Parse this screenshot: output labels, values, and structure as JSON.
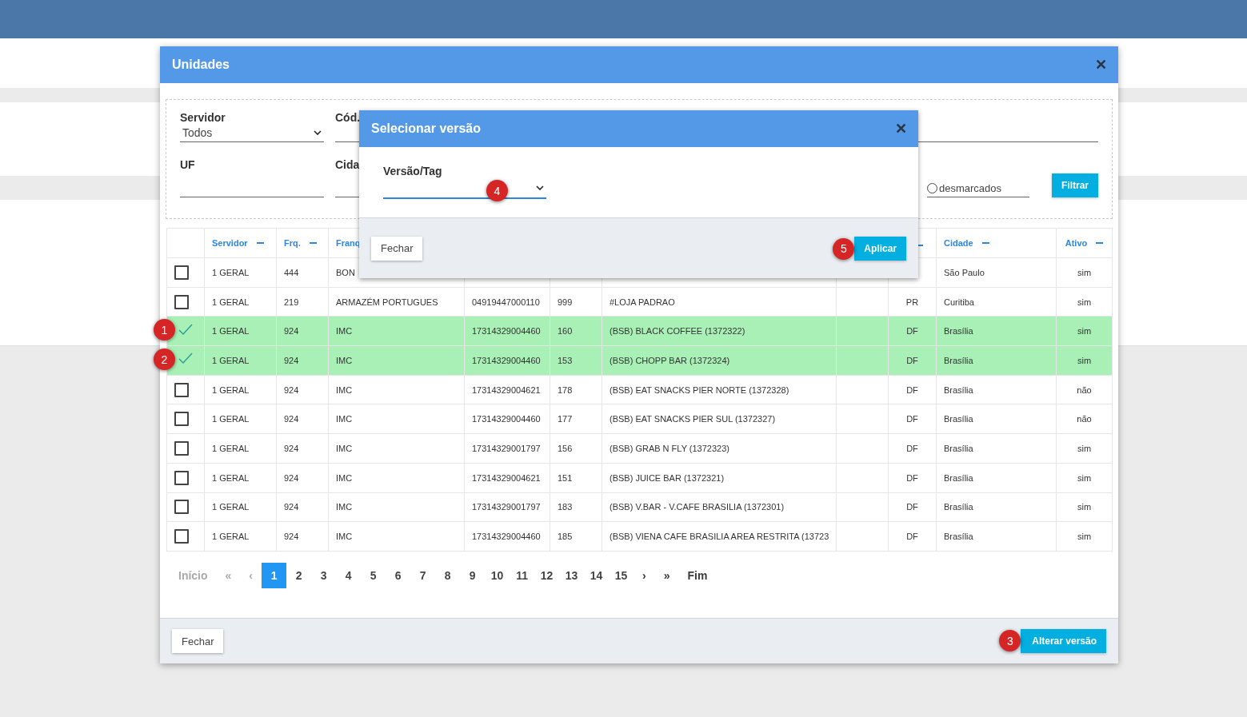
{
  "modal": {
    "title": "Unidades",
    "close": "✕"
  },
  "filters": {
    "server": {
      "label": "Servidor",
      "value": "Todos"
    },
    "code": {
      "label": "Cód."
    },
    "uf": {
      "label": "UF"
    },
    "city": {
      "label": "Cida"
    },
    "radio": {
      "label": "desmarcados",
      "selected": false
    },
    "filter_button": "Filtrar"
  },
  "table": {
    "columns": [
      {
        "label": "Servidor",
        "sort_icon": true
      },
      {
        "label": "Frq.",
        "sort_icon": true
      },
      {
        "label": "Franq",
        "sort_icon": false
      },
      {},
      {},
      {},
      {},
      {
        "sort_icon": true
      },
      {
        "label": "Cidade",
        "sort_icon": true
      },
      {
        "label": "Ativo",
        "sort_icon": true
      }
    ],
    "rows": [
      {
        "selected": false,
        "cells": [
          "1 GERAL",
          "444",
          "BON",
          "",
          "",
          "",
          "",
          "",
          "São Paulo",
          "sim"
        ]
      },
      {
        "selected": false,
        "cells": [
          "1 GERAL",
          "219",
          "ARMAZÉM PORTUGUES",
          "04919447000110",
          "999",
          "#LOJA PADRAO",
          "",
          "PR",
          "Curitiba",
          "sim"
        ]
      },
      {
        "selected": true,
        "badge": "1",
        "cells": [
          "1 GERAL",
          "924",
          "IMC",
          "17314329004460",
          "160",
          "(BSB) BLACK COFFEE (1372322)",
          "",
          "DF",
          "Brasília",
          "sim"
        ]
      },
      {
        "selected": true,
        "badge": "2",
        "cells": [
          "1 GERAL",
          "924",
          "IMC",
          "17314329004460",
          "153",
          "(BSB) CHOPP BAR (1372324)",
          "",
          "DF",
          "Brasília",
          "sim"
        ]
      },
      {
        "selected": false,
        "cells": [
          "1 GERAL",
          "924",
          "IMC",
          "17314329004621",
          "178",
          "(BSB) EAT SNACKS PIER NORTE (1372328)",
          "",
          "DF",
          "Brasília",
          "não"
        ]
      },
      {
        "selected": false,
        "cells": [
          "1 GERAL",
          "924",
          "IMC",
          "17314329004460",
          "177",
          "(BSB) EAT SNACKS PIER SUL (1372327)",
          "",
          "DF",
          "Brasília",
          "não"
        ]
      },
      {
        "selected": false,
        "cells": [
          "1 GERAL",
          "924",
          "IMC",
          "17314329001797",
          "156",
          "(BSB) GRAB N FLY (1372323)",
          "",
          "DF",
          "Brasília",
          "sim"
        ]
      },
      {
        "selected": false,
        "cells": [
          "1 GERAL",
          "924",
          "IMC",
          "17314329004621",
          "151",
          "(BSB) JUICE BAR (1372321)",
          "",
          "DF",
          "Brasília",
          "sim"
        ]
      },
      {
        "selected": false,
        "cells": [
          "1 GERAL",
          "924",
          "IMC",
          "17314329001797",
          "183",
          "(BSB) V.BAR - V.CAFE BRASILIA (1372301)",
          "",
          "DF",
          "Brasília",
          "sim"
        ]
      },
      {
        "selected": false,
        "cells": [
          "1 GERAL",
          "924",
          "IMC",
          "17314329004460",
          "185",
          "(BSB) VIENA CAFE BRASILIA AREA RESTRITA (13723",
          "",
          "DF",
          "Brasília",
          "sim"
        ]
      }
    ]
  },
  "pagination": [
    {
      "label": "Início",
      "kind": "nav",
      "disabled": true,
      "selected": false
    },
    {
      "label": "«",
      "kind": "nav",
      "disabled": true,
      "selected": false
    },
    {
      "label": "‹",
      "kind": "nav",
      "disabled": true,
      "selected": false
    },
    {
      "label": "1",
      "kind": "page",
      "disabled": false,
      "selected": true
    },
    {
      "label": "2",
      "kind": "page",
      "disabled": false,
      "selected": false
    },
    {
      "label": "3",
      "kind": "page",
      "disabled": false,
      "selected": false
    },
    {
      "label": "4",
      "kind": "page",
      "disabled": false,
      "selected": false
    },
    {
      "label": "5",
      "kind": "page",
      "disabled": false,
      "selected": false
    },
    {
      "label": "6",
      "kind": "page",
      "disabled": false,
      "selected": false
    },
    {
      "label": "7",
      "kind": "page",
      "disabled": false,
      "selected": false
    },
    {
      "label": "8",
      "kind": "page",
      "disabled": false,
      "selected": false
    },
    {
      "label": "9",
      "kind": "page",
      "disabled": false,
      "selected": false
    },
    {
      "label": "10",
      "kind": "page",
      "disabled": false,
      "selected": false
    },
    {
      "label": "11",
      "kind": "page",
      "disabled": false,
      "selected": false
    },
    {
      "label": "12",
      "kind": "page",
      "disabled": false,
      "selected": false
    },
    {
      "label": "13",
      "kind": "page",
      "disabled": false,
      "selected": false
    },
    {
      "label": "14",
      "kind": "page",
      "disabled": false,
      "selected": false
    },
    {
      "label": "15",
      "kind": "page",
      "disabled": false,
      "selected": false
    },
    {
      "label": "›",
      "kind": "nav",
      "disabled": false,
      "selected": false
    },
    {
      "label": "»",
      "kind": "nav",
      "disabled": false,
      "selected": false
    },
    {
      "label": "Fim",
      "kind": "nav",
      "disabled": false,
      "selected": false
    }
  ],
  "footer": {
    "close_button": "Fechar",
    "change_button": "Alterar versão",
    "change_badge": "3"
  },
  "dialog": {
    "title": "Selecionar versão",
    "close": "✕",
    "field_label": "Versão/Tag",
    "field_badge": "4",
    "close_button": "Fechar",
    "apply_button": "Aplicar",
    "apply_badge": "5"
  }
}
